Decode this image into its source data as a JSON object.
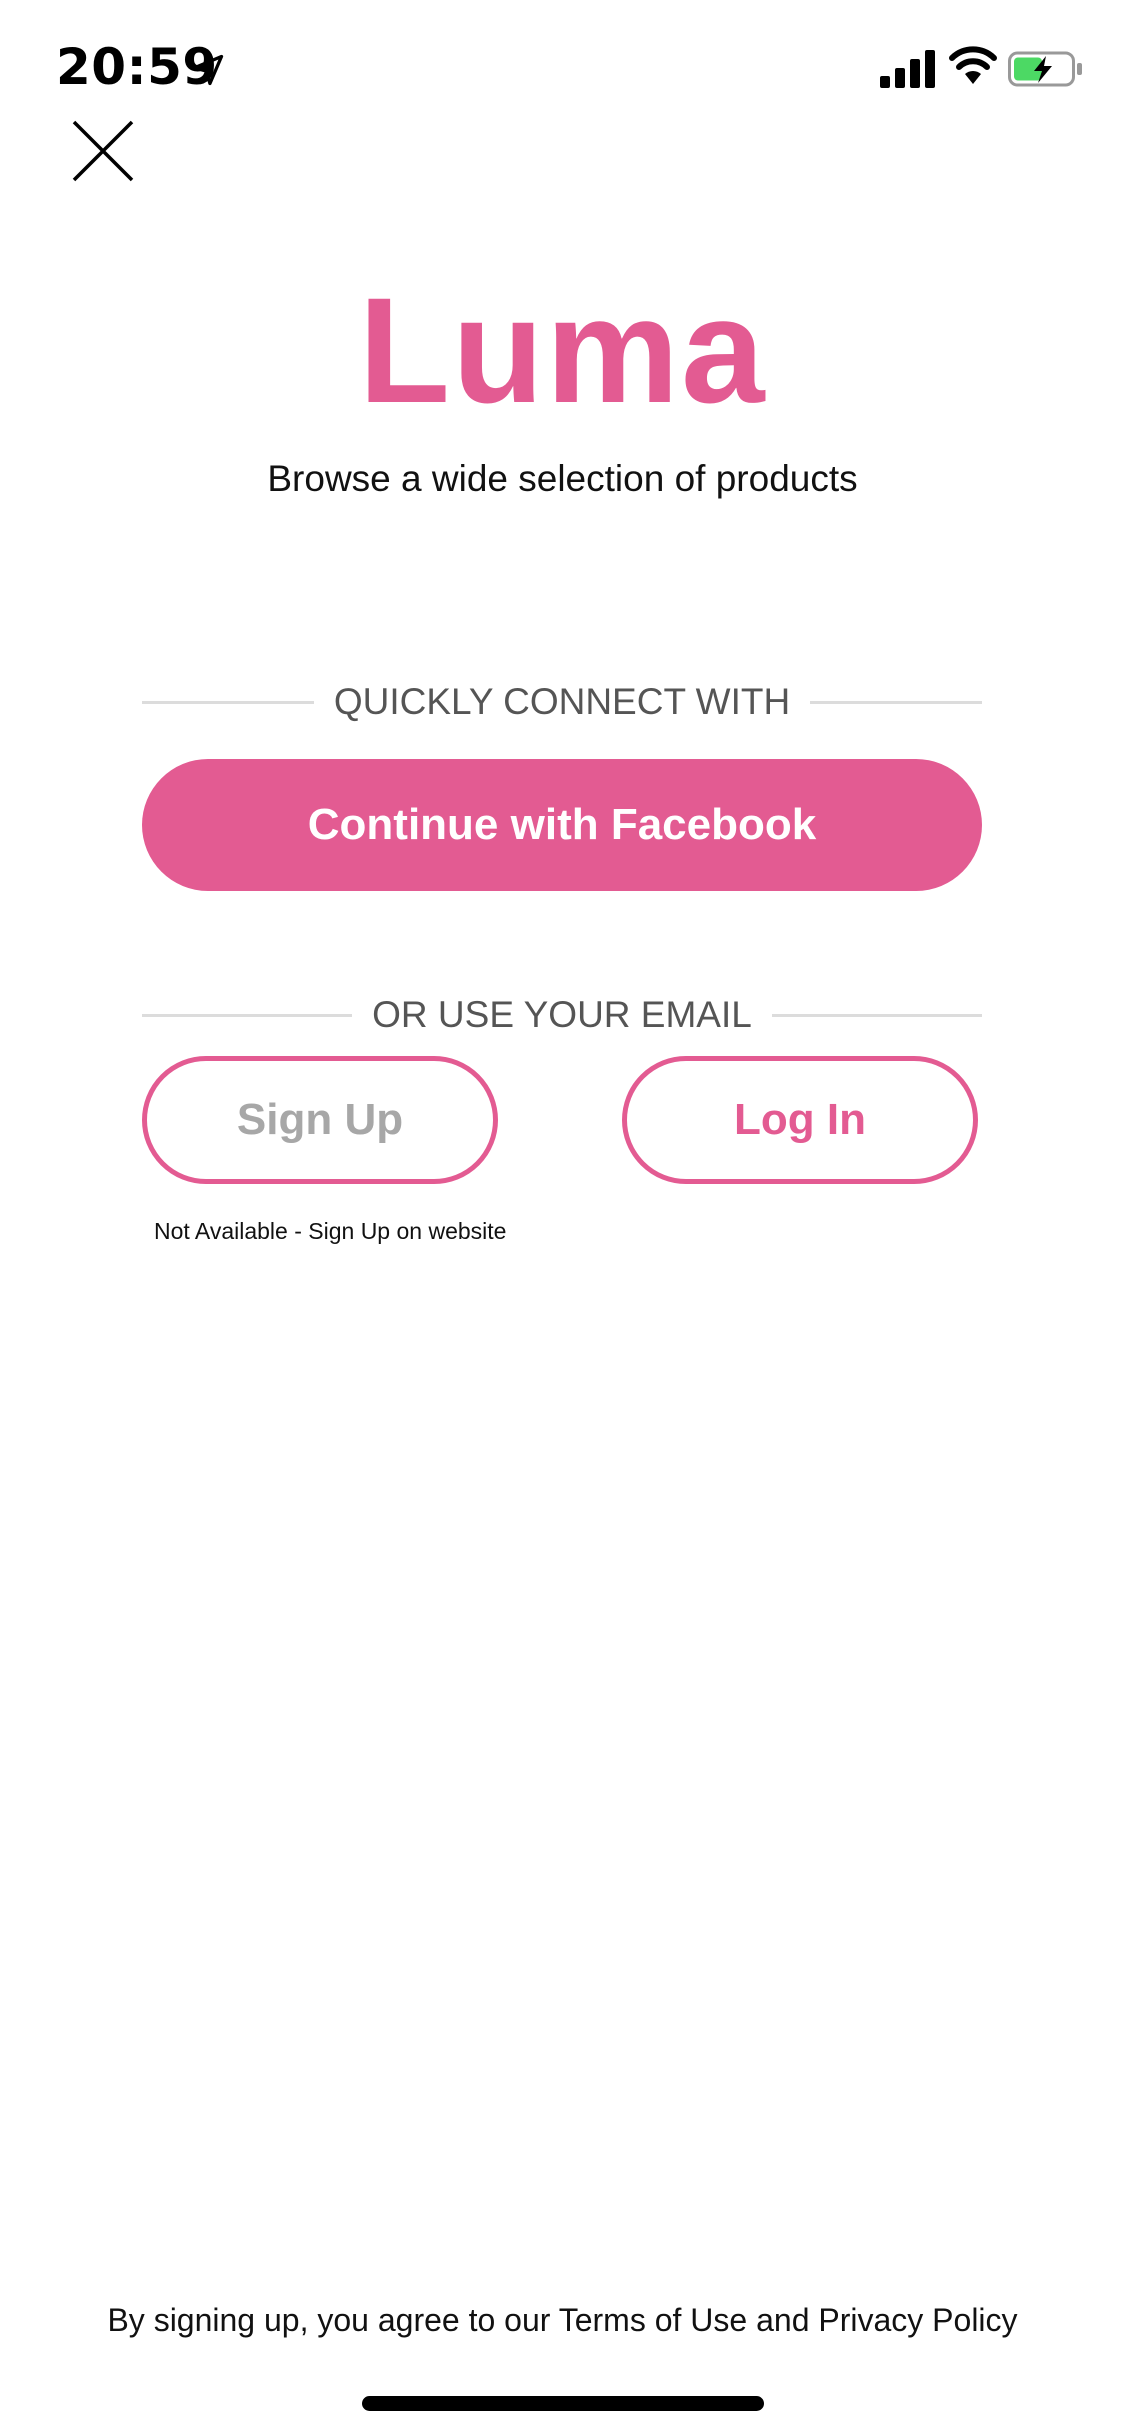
{
  "status_bar": {
    "time": "20:59",
    "icons": [
      "location-arrow-icon",
      "cellular-signal-icon",
      "wifi-icon",
      "battery-charging-icon"
    ],
    "battery_color": "#4CD964"
  },
  "brand": {
    "name": "Luma",
    "color": "#E35B92"
  },
  "tagline": "Browse a wide selection of products",
  "quick_connect": {
    "heading": "QUICKLY CONNECT WITH",
    "facebook_label": "Continue with Facebook"
  },
  "email": {
    "heading": "OR USE YOUR EMAIL",
    "signup_label": "Sign Up",
    "login_label": "Log In",
    "signup_note": "Not Available - Sign Up on website"
  },
  "legal": {
    "prefix": "By signing up, you agree to our ",
    "terms": "Terms of Use",
    "connector": " and ",
    "privacy": "Privacy Policy"
  }
}
